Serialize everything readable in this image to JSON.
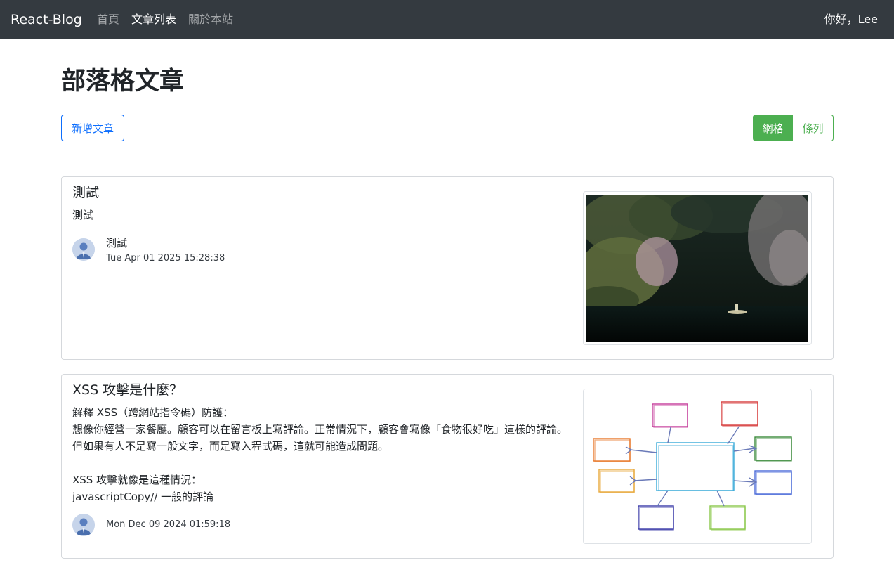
{
  "navbar": {
    "brand": "React-Blog",
    "links": [
      {
        "label": "首頁"
      },
      {
        "label": "文章列表"
      },
      {
        "label": "關於本站"
      }
    ],
    "user_greeting": "你好，Lee"
  },
  "page": {
    "title": "部落格文章",
    "new_post_button": "新增文章",
    "view_toggle": {
      "grid": "網格",
      "list": "條列",
      "selected": "grid"
    }
  },
  "posts": [
    {
      "title": "測試",
      "excerpt": "測試",
      "author": "測試",
      "date": "Tue Apr 01 2025 15:28:38",
      "image_icon": "lake-forest-photo"
    },
    {
      "title": "XSS 攻擊是什麼？",
      "excerpt": "解釋 XSS（跨網站指令碼）防護：\n想像你經營一家餐廳。顧客可以在留言板上寫評論。正常情況下，顧客會寫像「食物很好吃」這樣的評論。但如果有人不是寫一般文字，而是寫入程式碼，這就可能造成問題。\n\nXSS 攻擊就像是這種情況：\njavascriptCopy// 一般的評論",
      "author": "",
      "date": "Mon Dec 09 2024 01:59:18",
      "image_icon": "flowchart-sketch-image"
    }
  ],
  "colors": {
    "navbar_bg": "#343a40",
    "primary": "#0d6efd",
    "toggle_green": "#4caf50"
  }
}
